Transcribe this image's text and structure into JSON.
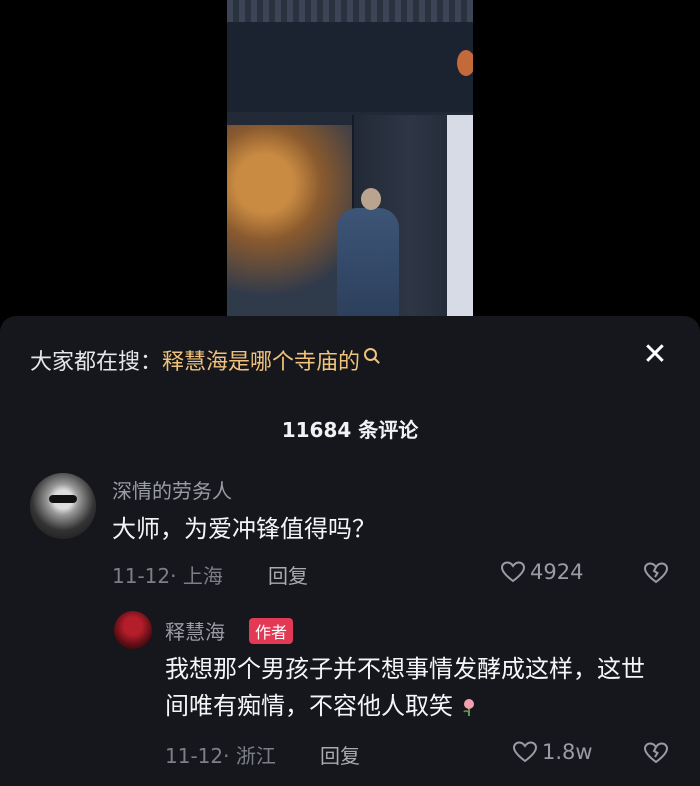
{
  "search": {
    "prefix": "大家都在搜：",
    "query": "释慧海是哪个寺庙的"
  },
  "comments_header": {
    "count_label": "11684 条评论"
  },
  "comments": [
    {
      "username": "深情的劳务人",
      "text": "大师，为爱冲锋值得吗？",
      "meta": "11-12· 上海",
      "reply_label": "回复",
      "likes": "4924"
    }
  ],
  "replies": [
    {
      "username": "释慧海",
      "badge": "作者",
      "text": "我想那个男孩子并不想事情发酵成这样，这世间唯有痴情，不容他人取笑",
      "meta": "11-12· 浙江",
      "reply_label": "回复",
      "likes": "1.8w"
    }
  ],
  "icons": {
    "close": "close-icon",
    "search": "search-icon",
    "like": "heart-icon",
    "dislike": "broken-heart-icon",
    "emoji": "rose-icon"
  },
  "colors": {
    "search_highlight": "#f0c27b",
    "author_badge": "#e23a55",
    "sheet_background": "#15171c"
  }
}
